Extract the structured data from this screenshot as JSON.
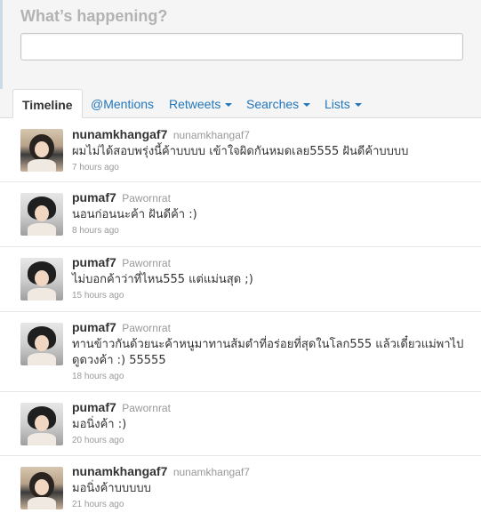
{
  "compose": {
    "title": "What’s happening?",
    "value": ""
  },
  "tabs": [
    {
      "label": "Timeline"
    },
    {
      "label": "@Mentions"
    },
    {
      "label": "Retweets"
    },
    {
      "label": "Searches"
    },
    {
      "label": "Lists"
    }
  ],
  "tweets": [
    {
      "username": "nunamkhangaf7",
      "fullname": "nunamkhangaf7",
      "text": "ผมไม่ได้สอบพรุ่งนี้ค้าบบบบ เข้าใจผิดกันหมดเลย5555 ฝันดีค้าบบบบ",
      "time": "7 hours ago"
    },
    {
      "username": "pumaf7",
      "fullname": "Pawornrat",
      "text": "นอนก่อนนะค้า ฝันดีค้า :)",
      "time": "8 hours ago"
    },
    {
      "username": "pumaf7",
      "fullname": "Pawornrat",
      "text": "ไม่บอกค้าว่าที่ไหน555 แต่แม่นสุด ;)",
      "time": "15 hours ago"
    },
    {
      "username": "pumaf7",
      "fullname": "Pawornrat",
      "text": "ทานข้าวกันด้วยนะค้าหนูมาทานส้มตำที่อร่อยที่สุดในโลก555 แล้วเดี๋ยวแม่พาไปดูดวงค้า :) 55555",
      "time": "18 hours ago"
    },
    {
      "username": "pumaf7",
      "fullname": "Pawornrat",
      "text": "มอนิ่งค้า :)",
      "time": "20 hours ago"
    },
    {
      "username": "nunamkhangaf7",
      "fullname": "nunamkhangaf7",
      "text": "มอนิ่งค้าบบบบบ",
      "time": "21 hours ago"
    }
  ]
}
